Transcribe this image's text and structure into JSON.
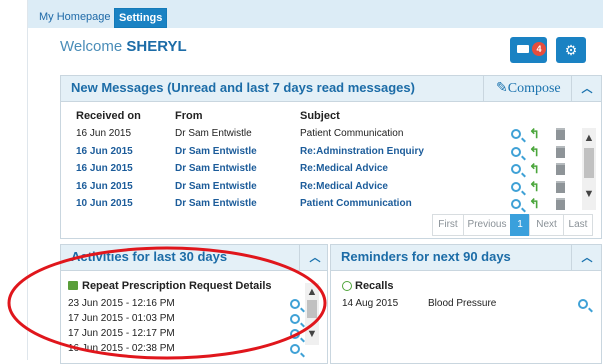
{
  "tabs": [
    "My Homepage",
    "Settings"
  ],
  "welcome": {
    "prefix": "Welcome",
    "name": "SHERYL"
  },
  "header": {
    "mail_badge": "4"
  },
  "messages": {
    "title": "New Messages (Unread and last 7 days read messages)",
    "compose_label": "Compose",
    "columns": [
      "Received on",
      "From",
      "Subject"
    ],
    "rows": [
      {
        "date": "16 Jun 2015",
        "from": "Dr Sam Entwistle",
        "subject": "Patient Communication",
        "unread": false
      },
      {
        "date": "16 Jun 2015",
        "from": "Dr Sam Entwistle",
        "subject": "Re:Adminstration Enquiry",
        "unread": true
      },
      {
        "date": "16 Jun 2015",
        "from": "Dr Sam Entwistle",
        "subject": "Re:Medical Advice",
        "unread": true
      },
      {
        "date": "16 Jun 2015",
        "from": "Dr Sam Entwistle",
        "subject": "Re:Medical Advice",
        "unread": true
      },
      {
        "date": "10 Jun 2015",
        "from": "Dr Sam Entwistle",
        "subject": "Patient Communication",
        "unread": true
      }
    ],
    "pager": [
      "First",
      "Previous",
      "1",
      "Next",
      "Last"
    ]
  },
  "activities": {
    "title": "Activities for last 30 days",
    "section_title": "Repeat Prescription Request Details",
    "items": [
      "23 Jun 2015 - 12:16 PM",
      "17 Jun 2015 - 01:03 PM",
      "17 Jun 2015 - 12:17 PM",
      "16 Jun 2015 - 02:38 PM"
    ]
  },
  "reminders": {
    "title": "Reminders for next 90 days",
    "section_title": "Recalls",
    "items": [
      {
        "date": "14 Aug 2015",
        "label": "Blood Pressure"
      }
    ]
  },
  "colors": {
    "accent": "#1a82c3",
    "annotation": "#e0161c",
    "link": "#1c5c9a"
  }
}
